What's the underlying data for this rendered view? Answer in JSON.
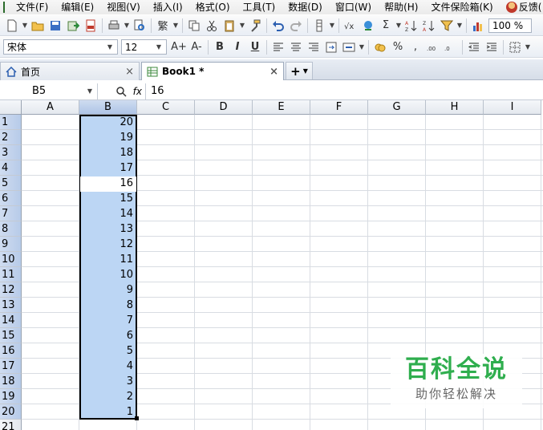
{
  "menu": [
    "文件(F)",
    "编辑(E)",
    "视图(V)",
    "插入(I)",
    "格式(O)",
    "工具(T)",
    "数据(D)",
    "窗口(W)",
    "帮助(H)",
    "文件保险箱(K)",
    "反馈("
  ],
  "toolbar": {
    "zoom": "100 %",
    "font_name": "宋体",
    "font_size": "12",
    "bold": "B",
    "italic": "I",
    "underline": "U",
    "sum_symbol": "Σ",
    "percent": "%",
    "comma": ",",
    "traditional": "繁",
    "font_grow": "A+",
    "font_shrink": "A-"
  },
  "tabs": [
    {
      "label": "首页",
      "close": "×"
    },
    {
      "label": "Book1 *",
      "close": "×"
    }
  ],
  "new_tab": "+",
  "formula_bar": {
    "name_box": "B5",
    "fx": "fx",
    "value": "16"
  },
  "columns": [
    "A",
    "B",
    "C",
    "D",
    "E",
    "F",
    "G",
    "H",
    "I"
  ],
  "selected_column": "B",
  "rows": [
    "1",
    "2",
    "3",
    "4",
    "5",
    "6",
    "7",
    "8",
    "9",
    "10",
    "11",
    "12",
    "13",
    "14",
    "15",
    "16",
    "17",
    "18",
    "19",
    "20",
    "21"
  ],
  "column_b_values": [
    "20",
    "19",
    "18",
    "17",
    "16",
    "15",
    "14",
    "13",
    "12",
    "11",
    "10",
    "9",
    "8",
    "7",
    "6",
    "5",
    "4",
    "3",
    "2",
    "1"
  ],
  "selected_range": "B1:B20",
  "active_cell": "B5",
  "watermark": {
    "title": "百科全说",
    "subtitle": "助你轻松解决"
  },
  "colors": {
    "selection_fill": "#bcd6f4",
    "watermark_green": "#2fae4e"
  }
}
